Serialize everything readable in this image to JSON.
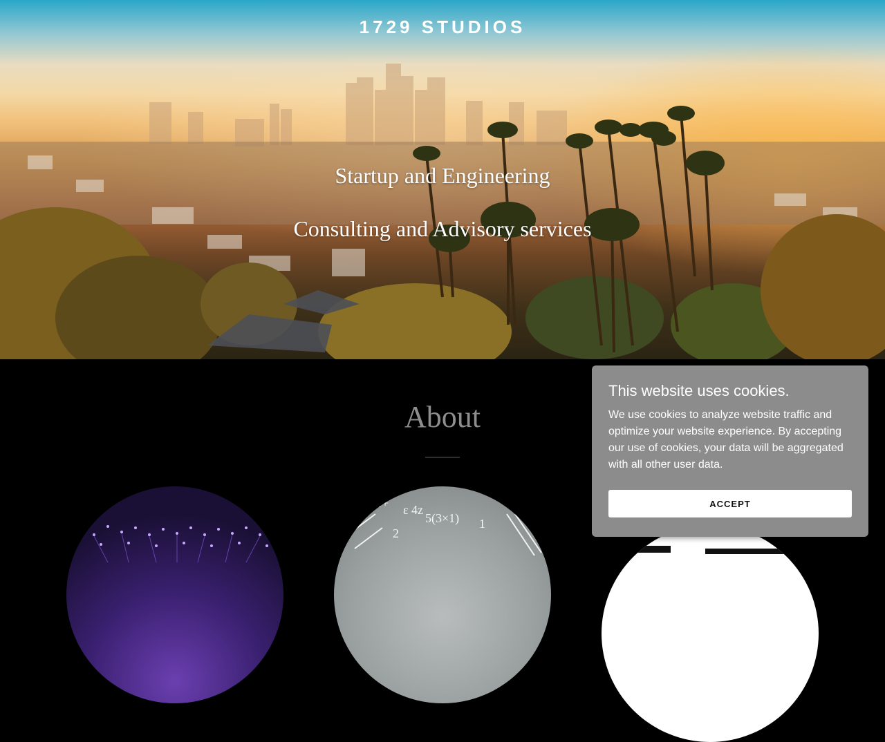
{
  "header": {
    "brand": "1729 STUDIOS"
  },
  "hero": {
    "line1": "Startup and Engineering",
    "line2": "Consulting and Advisory services",
    "image": "los-angeles-skyline-palm-trees"
  },
  "about": {
    "title": "About",
    "cards": [
      {
        "image": "purple-fiber-optics"
      },
      {
        "image": "chalkboard-math-equations"
      },
      {
        "image": "logo-partial"
      }
    ]
  },
  "cookie_banner": {
    "title": "This website uses cookies.",
    "text": "We use cookies to analyze website traffic and optimize your website experience. By accepting our use of cookies, your data will be aggregated with all other user data.",
    "accept_label": "ACCEPT",
    "background": "#8c8c8c"
  }
}
